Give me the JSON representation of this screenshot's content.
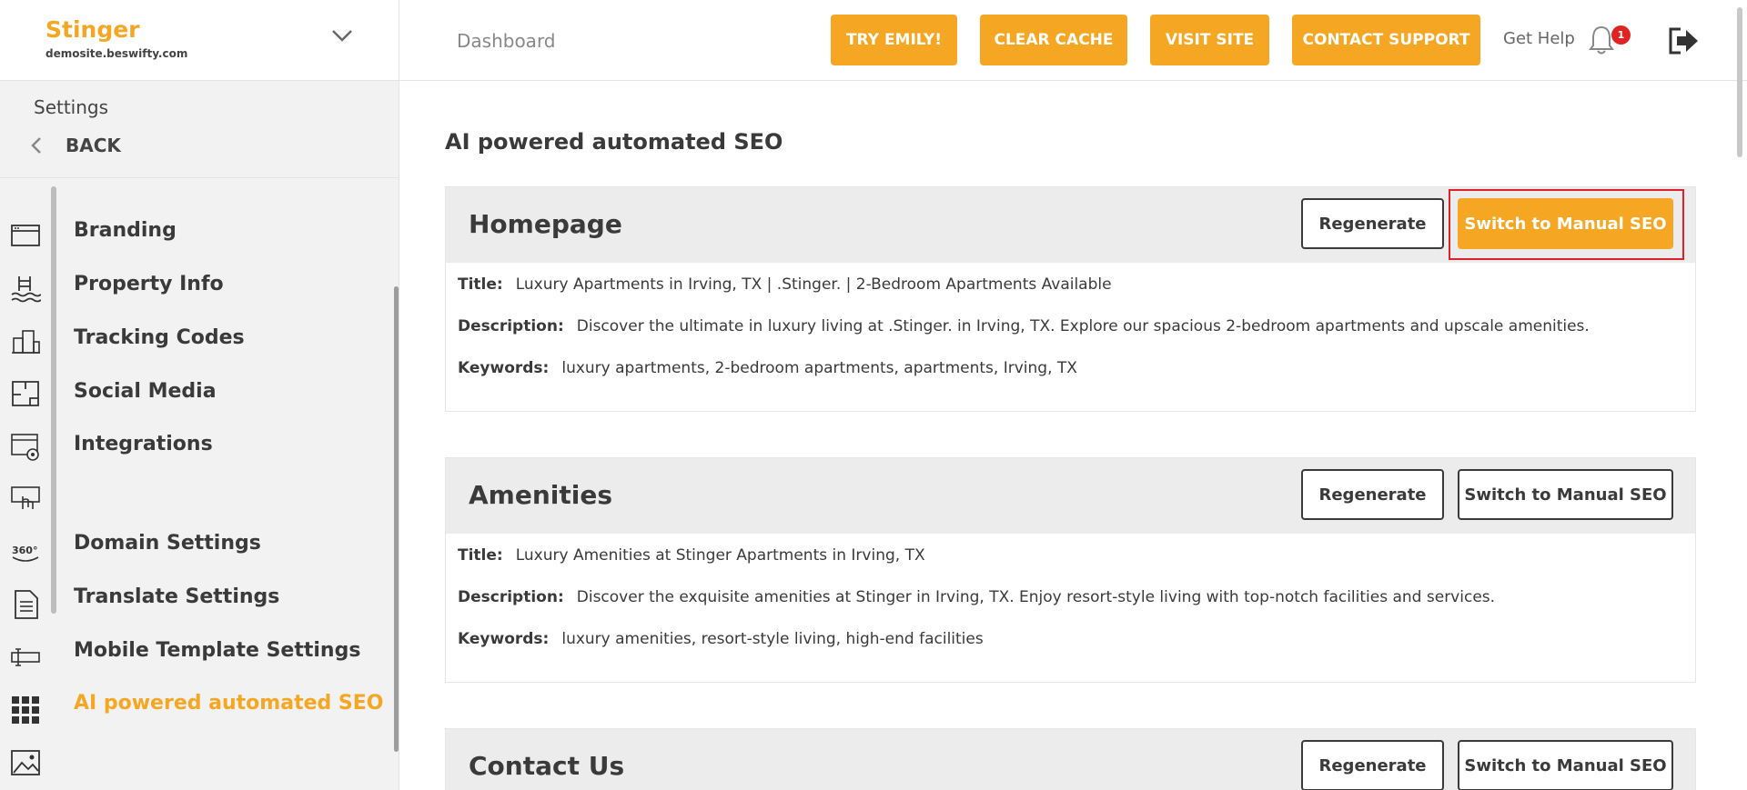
{
  "brand": {
    "name": "Stinger",
    "domain": "demosite.beswifty.com"
  },
  "settings": {
    "label": "Settings",
    "back_label": "BACK"
  },
  "menu": [
    "Branding",
    "Property Info",
    "Tracking Codes",
    "Social Media",
    "Integrations",
    "Domain Settings",
    "Translate Settings",
    "Mobile Template Settings",
    "AI powered automated SEO"
  ],
  "rail_icons": [
    "browser-window-icon",
    "pool-icon",
    "buildings-icon",
    "floorplan-icon",
    "browser-settings-icon",
    "touch-screen-icon",
    "tour-360-icon",
    "document-icon",
    "text-input-icon",
    "grid-apps-icon",
    "image-icon"
  ],
  "rail_360_text": "360°",
  "header": {
    "breadcrumb": "Dashboard",
    "buttons": [
      "TRY EMILY!",
      "CLEAR CACHE",
      "VISIT SITE",
      "CONTACT SUPPORT"
    ],
    "get_help": "Get Help",
    "notification_count": "1"
  },
  "main": {
    "title": "AI powered automated SEO",
    "field_labels": {
      "title": "Title:",
      "description": "Description:",
      "keywords": "Keywords:"
    },
    "regenerate_label": "Regenerate",
    "manual_label": "Switch to Manual SEO",
    "cards": [
      {
        "name": "Homepage",
        "title": "Luxury Apartments in Irving, TX | .Stinger. | 2-Bedroom Apartments Available",
        "description": "Discover the ultimate in luxury living at .Stinger. in Irving, TX. Explore our spacious 2-bedroom apartments and upscale amenities.",
        "keywords": "luxury apartments, 2-bedroom apartments, apartments, Irving, TX"
      },
      {
        "name": "Amenities",
        "title": "Luxury Amenities at Stinger Apartments in Irving, TX",
        "description": "Discover the exquisite amenities at Stinger in Irving, TX. Enjoy resort-style living with top-notch facilities and services.",
        "keywords": "luxury amenities, resort-style living, high-end facilities"
      },
      {
        "name": "Contact Us"
      }
    ]
  },
  "colors": {
    "accent": "#f5a623",
    "highlight": "#e0202b",
    "badge": "#e02424"
  }
}
